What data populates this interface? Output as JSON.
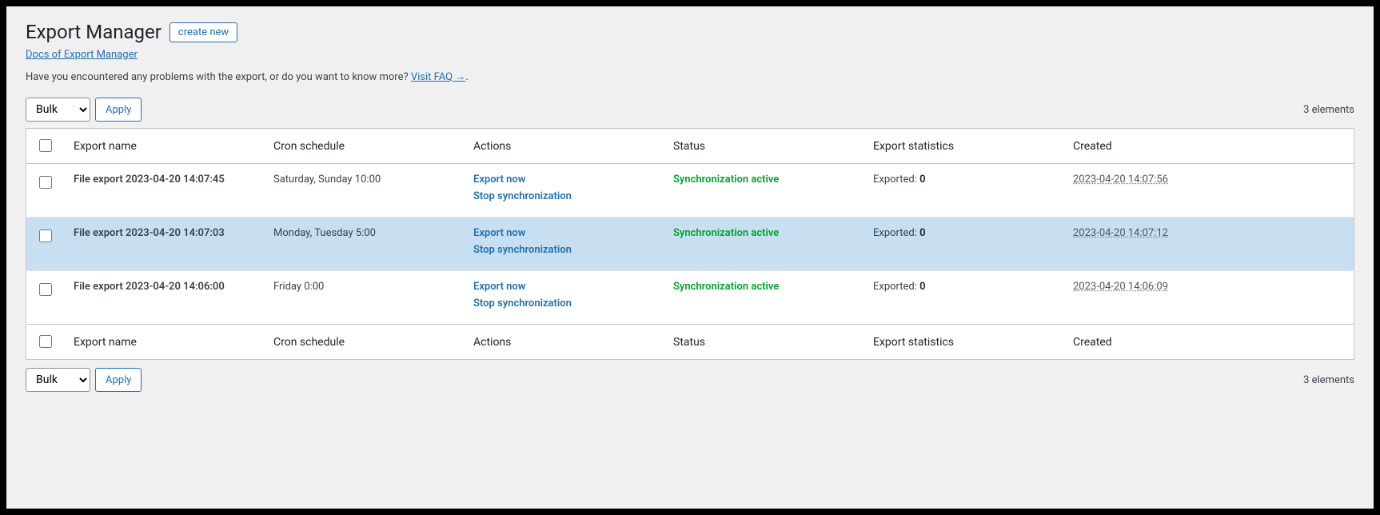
{
  "header": {
    "title": "Export Manager",
    "create_label": "create new",
    "docs_link": "Docs of Export Manager",
    "help_text": "Have you encountered any problems with the export, or do you want to know more? ",
    "help_link": "Visit FAQ →"
  },
  "bulk": {
    "select_value": "Bulk",
    "apply_label": "Apply",
    "count_text": "3 elements"
  },
  "columns": {
    "name": "Export name",
    "cron": "Cron schedule",
    "actions": "Actions",
    "status": "Status",
    "stats": "Export statistics",
    "created": "Created"
  },
  "action_labels": {
    "export_now": "Export now",
    "stop_sync": "Stop synchronization"
  },
  "stats_label": "Exported: ",
  "rows": [
    {
      "name": "File export 2023-04-20 14:07:45",
      "cron": "Saturday, Sunday 10:00",
      "status": "Synchronization active",
      "exported": "0",
      "created": "2023-04-20 14:07:56",
      "highlight": false
    },
    {
      "name": "File export 2023-04-20 14:07:03",
      "cron": "Monday, Tuesday 5:00",
      "status": "Synchronization active",
      "exported": "0",
      "created": "2023-04-20 14:07:12",
      "highlight": true
    },
    {
      "name": "File export 2023-04-20 14:06:00",
      "cron": "Friday 0:00",
      "status": "Synchronization active",
      "exported": "0",
      "created": "2023-04-20 14:06:09",
      "highlight": false
    }
  ]
}
